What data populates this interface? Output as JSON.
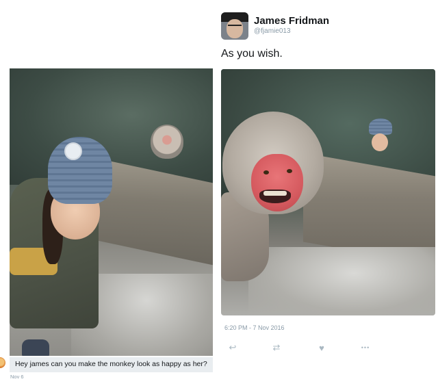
{
  "request_tweet": {
    "text": "Hey james can you make the monkey look as happy as her?",
    "date": "Nov 6"
  },
  "reply_tweet": {
    "display_name": "James Fridman",
    "handle": "@fjamie013",
    "text": "As you wish.",
    "timestamp": "6:20 PM - 7 Nov 2016"
  },
  "actions": [
    {
      "icon": "reply-icon",
      "glyph": "↩"
    },
    {
      "icon": "retweet-icon",
      "glyph": "⇄"
    },
    {
      "icon": "like-heart-icon",
      "glyph": "♥"
    },
    {
      "icon": "more-icon",
      "glyph": "•••"
    }
  ],
  "colors": {
    "text_primary": "#14171a",
    "text_secondary": "#8899a6",
    "action_gray": "#aab8c2",
    "caption_bg": "#e9edf0"
  }
}
